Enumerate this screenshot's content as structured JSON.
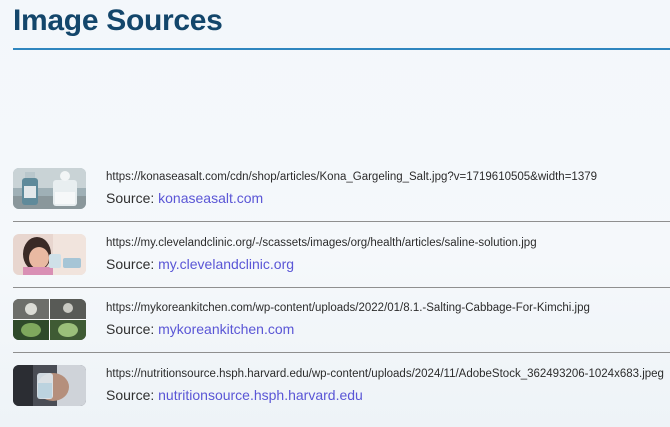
{
  "page": {
    "title": "Image Sources"
  },
  "sources": [
    {
      "url": "https://konaseasalt.com/cdn/shop/articles/Kona_Gargeling_Salt.jpg?v=1719610505&width=1379",
      "label": "Source: ",
      "link": "konaseasalt.com"
    },
    {
      "url": "https://my.clevelandclinic.org/-/scassets/images/org/health/articles/saline-solution.jpg",
      "label": "Source: ",
      "link": "my.clevelandclinic.org"
    },
    {
      "url": "https://mykoreankitchen.com/wp-content/uploads/2022/01/8.1.-Salting-Cabbage-For-Kimchi.jpg",
      "label": "Source: ",
      "link": "mykoreankitchen.com"
    },
    {
      "url": "https://nutritionsource.hsph.harvard.edu/wp-content/uploads/2024/11/AdobeStock_362493206-1024x683.jpeg",
      "label": "Source: ",
      "link": "nutritionsource.hsph.harvard.edu"
    }
  ],
  "colors": {
    "title": "#13466b",
    "rule": "#2f86bf",
    "link": "#5a56d6"
  }
}
